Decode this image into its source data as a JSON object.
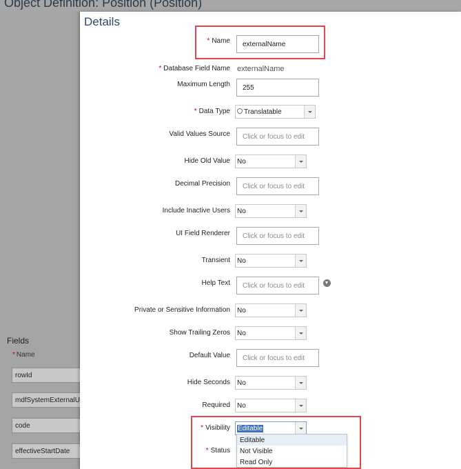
{
  "page": {
    "title": "Object Definition: Position (Position)"
  },
  "left_panel": {
    "fields_title": "Fields",
    "name_column": "Name",
    "fields": [
      "rowId",
      "mdfSystemExternalUs",
      "code",
      "effectiveStartDate"
    ]
  },
  "dialog": {
    "title": "Details",
    "rows": {
      "name": {
        "label": "Name",
        "required": true,
        "value": "externalName"
      },
      "db_field": {
        "label": "Database Field Name",
        "required": true,
        "value": "externalName"
      },
      "max_length": {
        "label": "Maximum Length",
        "value": "255"
      },
      "data_type": {
        "label": "Data Type",
        "required": true,
        "value": "Translatable"
      },
      "valid_values": {
        "label": "Valid Values Source",
        "placeholder": "Click or focus to edit"
      },
      "hide_old": {
        "label": "Hide Old Value",
        "value": "No"
      },
      "decimal": {
        "label": "Decimal Precision",
        "placeholder": "Click or focus to edit"
      },
      "include_inactive": {
        "label": "Include Inactive Users",
        "value": "No"
      },
      "ui_renderer": {
        "label": "UI Field Renderer",
        "placeholder": "Click or focus to edit"
      },
      "transient": {
        "label": "Transient",
        "value": "No"
      },
      "help_text": {
        "label": "Help Text",
        "placeholder": "Click or focus to edit"
      },
      "private": {
        "label": "Private or Sensitive Information",
        "value": "No"
      },
      "trailing": {
        "label": "Show Trailing Zeros",
        "value": "No"
      },
      "default_value": {
        "label": "Default Value",
        "placeholder": "Click or focus to edit"
      },
      "hide_seconds": {
        "label": "Hide Seconds",
        "value": "No"
      },
      "required": {
        "label": "Required",
        "value": "No"
      },
      "visibility": {
        "label": "Visibility",
        "required": true,
        "value": "Editable"
      },
      "status": {
        "label": "Status",
        "required": true
      }
    },
    "visibility_options": [
      "Editable",
      "Not Visible",
      "Read Only"
    ]
  },
  "colors": {
    "highlight": "#e3454a",
    "required": "#cc0000",
    "selection": "#3d6fbf"
  }
}
